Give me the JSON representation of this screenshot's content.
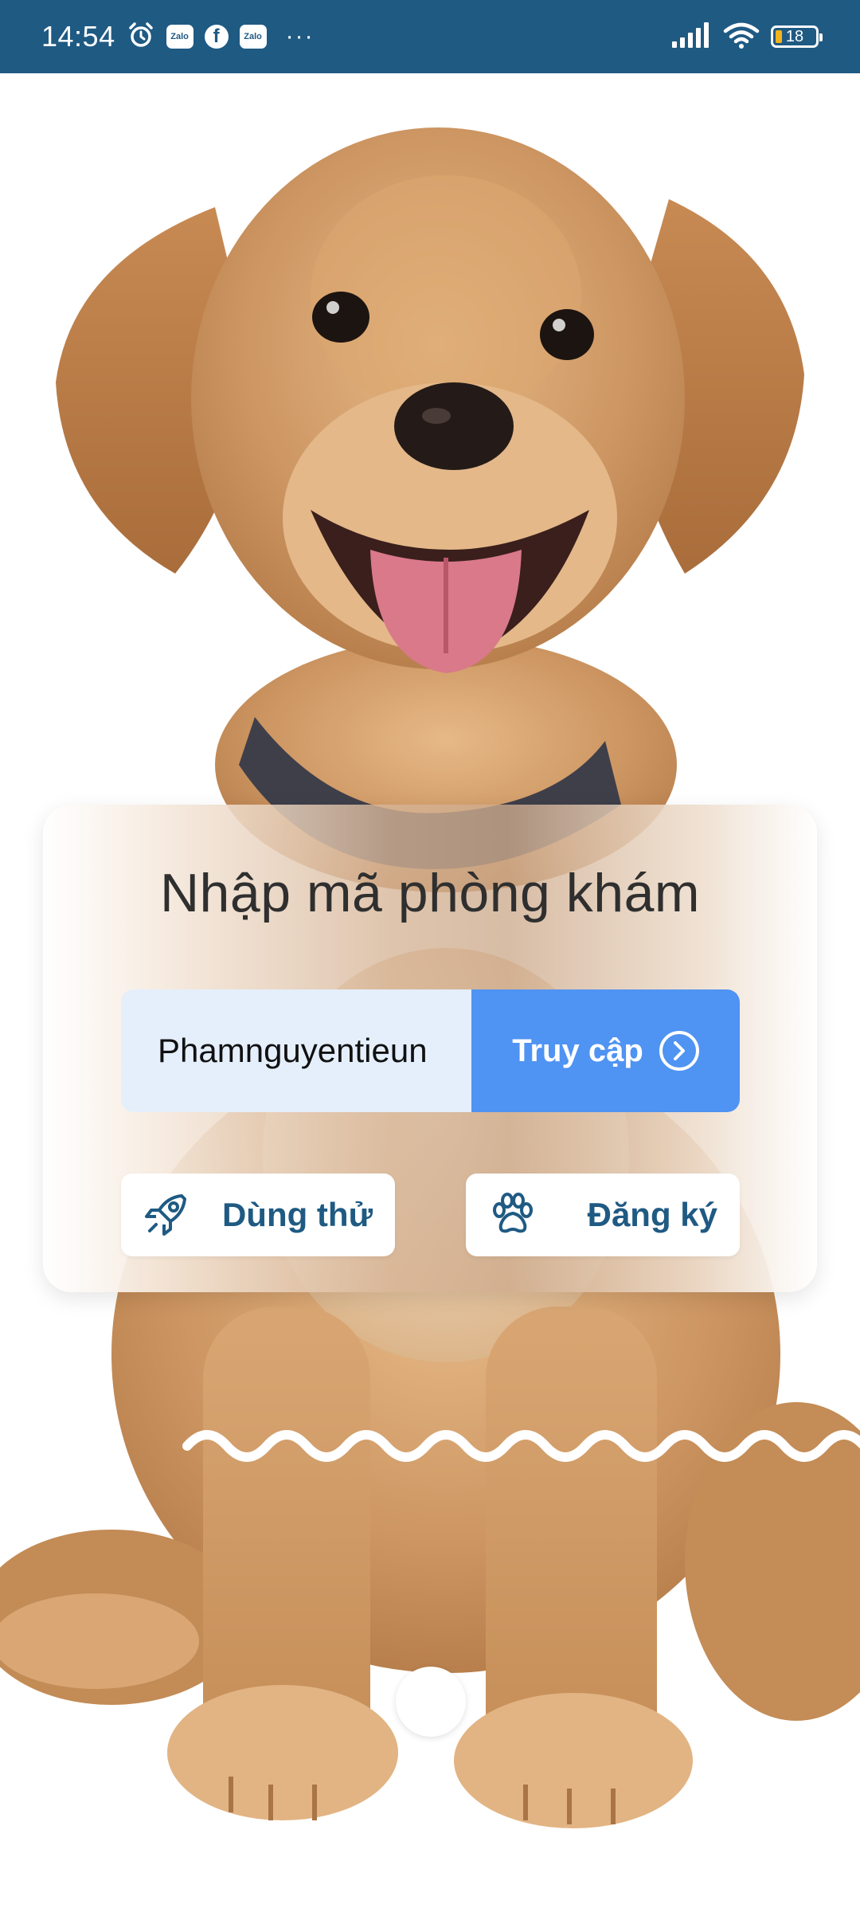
{
  "status_bar": {
    "time": "14:54",
    "notification_icons": [
      "alarm-icon",
      "zalo-icon",
      "facebook-icon",
      "zalo-icon"
    ],
    "zalo_label": "Zalo",
    "facebook_label": "f",
    "more_label": "···",
    "battery_level": "18",
    "background_color": "#1f5a83"
  },
  "login_card": {
    "title": "Nhập mã phòng khám",
    "clinic_code": {
      "value": "Phamnguyentieun"
    },
    "access_button": {
      "label": "Truy cập",
      "icon": "chevron-right-circle-icon",
      "color": "#4f93f3"
    },
    "trial_button": {
      "label": "Dùng thử",
      "icon": "rocket-icon"
    },
    "register_button": {
      "label": "Đăng ký",
      "icon": "paw-icon"
    },
    "accent_color": "#1f5a83"
  },
  "pager": {
    "active_index": 1,
    "total": 1
  }
}
